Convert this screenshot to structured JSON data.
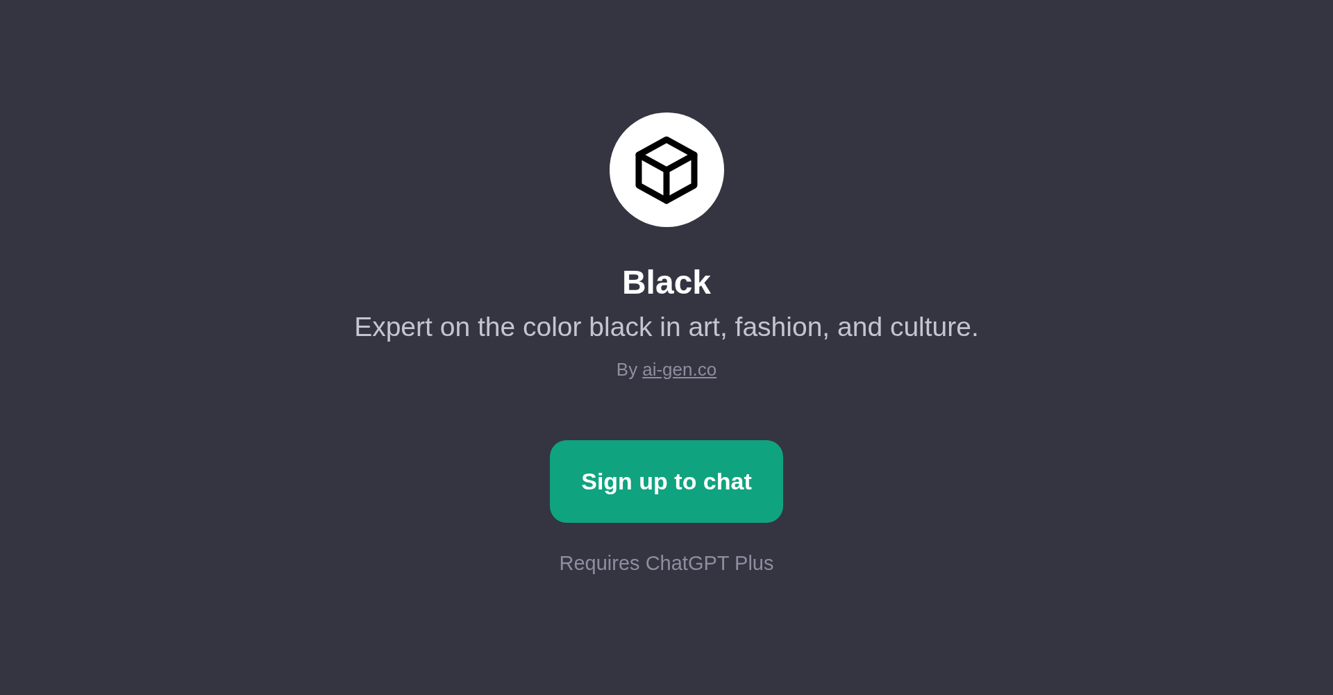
{
  "gpt": {
    "name": "Black",
    "description": "Expert on the color black in art, fashion, and culture.",
    "by_label": "By",
    "author_link": "ai-gen.co"
  },
  "signup_button": {
    "label": "Sign up to chat"
  },
  "note": "Requires ChatGPT Plus"
}
